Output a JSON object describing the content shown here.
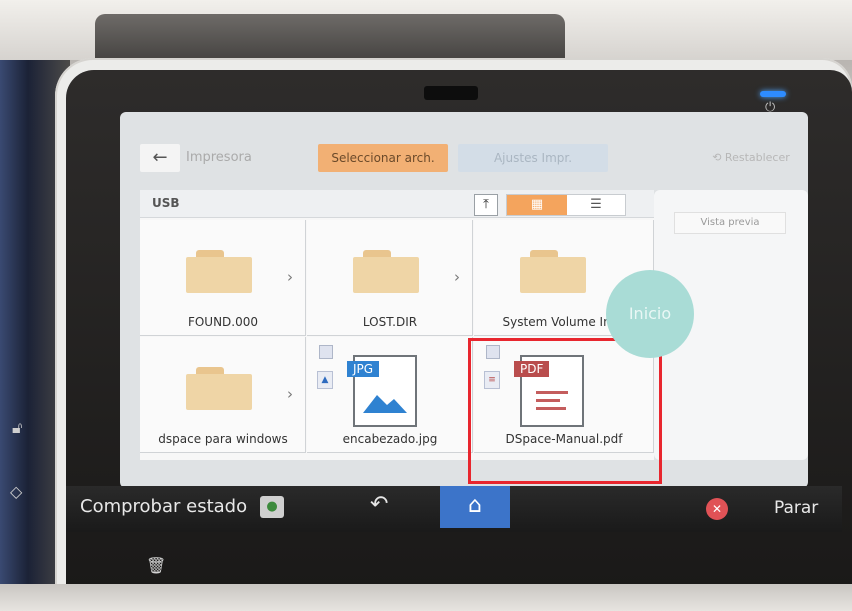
{
  "screen": {
    "topbar": {
      "back_icon": "arrow-left-icon",
      "crumb": "Impresora",
      "tab_select": "Seleccionar arch.",
      "tab_adjust": "Ajustes Impr.",
      "reset": "Restablecer"
    },
    "file_browser": {
      "location": "USB",
      "view_mode": "grid",
      "items": [
        {
          "name": "FOUND.000",
          "type": "folder"
        },
        {
          "name": "LOST.DIR",
          "type": "folder"
        },
        {
          "name": "System Volume Inf...",
          "type": "folder"
        },
        {
          "name": "dspace para windows",
          "type": "folder"
        },
        {
          "name": "encabezado.jpg",
          "type": "jpg",
          "badge": "JPG"
        },
        {
          "name": "DSpace-Manual.pdf",
          "type": "pdf",
          "badge": "PDF"
        }
      ],
      "highlighted_item": "DSpace-Manual.pdf",
      "highlight_color": "#e8262e"
    },
    "preview": {
      "button": "Vista previa",
      "start_button": "Inicio"
    }
  },
  "bottombar": {
    "status_label": "Comprobar estado",
    "undo_icon": "undo-icon",
    "home_icon": "home-icon",
    "stop_label": "Parar"
  },
  "colors": {
    "accent_orange": "#f4a45d",
    "home_blue": "#3c74c9",
    "start_teal": "#a9dcd6",
    "stop_red": "#e05256"
  }
}
